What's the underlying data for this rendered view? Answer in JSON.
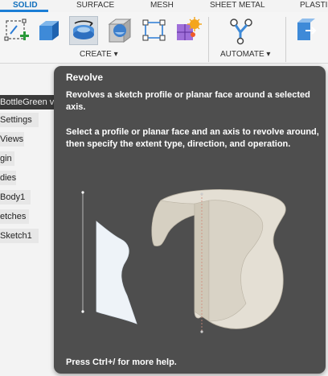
{
  "tabs": [
    {
      "label": "SOLID",
      "active": true
    },
    {
      "label": "SURFACE"
    },
    {
      "label": "MESH"
    },
    {
      "label": "SHEET METAL"
    },
    {
      "label": "PLASTI"
    }
  ],
  "toolbar": {
    "create_label": "CREATE ▾",
    "automate_label": "AUTOMATE ▾",
    "tools": [
      {
        "icon": "create-sketch-icon"
      },
      {
        "icon": "extrude-icon"
      },
      {
        "icon": "revolve-icon",
        "selected": true
      },
      {
        "icon": "hole-icon"
      },
      {
        "icon": "pattern-icon"
      },
      {
        "icon": "form-icon"
      },
      {
        "icon": "automate-icon"
      },
      {
        "icon": "insert-icon"
      }
    ]
  },
  "browser": {
    "items": [
      "BottleGreen v",
      "Settings",
      "Views",
      "gin",
      "dies",
      "Body1",
      "etches",
      "Sketch1"
    ]
  },
  "tooltip": {
    "title": "Revolve",
    "description": "Revolves a sketch profile or planar face around a selected axis.",
    "detail": "Select a profile or planar face and an axis to revolve around, then specify the extent type, direction, and operation.",
    "help": "Press Ctrl+/ for more help."
  },
  "colors": {
    "accent": "#1b7ed6",
    "tooltip_bg": "#4e4e4e",
    "profile_fill": "#eef3f8",
    "solid_fill": "#e4dfd4"
  }
}
